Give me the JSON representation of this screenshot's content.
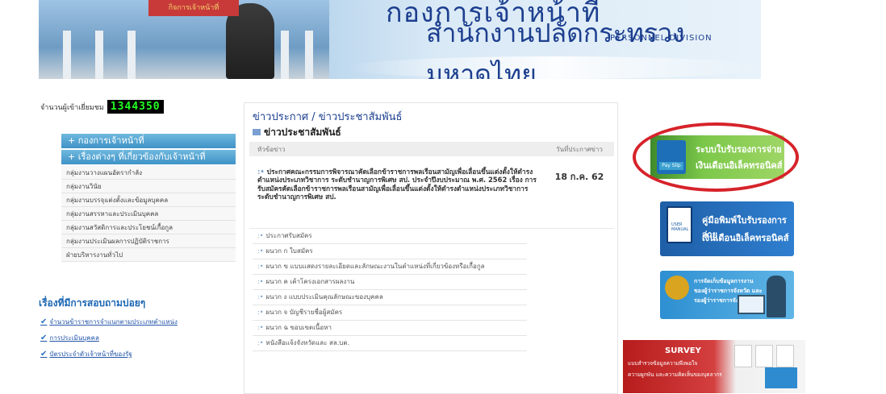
{
  "header": {
    "logo_text": "กิจการเจ้าหน้าที่",
    "title_line1": "กองการเจ้าหน้าที่",
    "title_line2": "สำนักงานปลัดกระทรวงมหาดไทย",
    "title_line3": "PERSONNEL DIVISION"
  },
  "visitor": {
    "label": "จำนวนผู้เข้าเยี่ยมชม",
    "count": "1344350"
  },
  "sidebar": {
    "section1": "+ กองการเจ้าหน้าที่",
    "section2": "+ เรื่องต่างๆ ที่เกี่ยวข้องกับเจ้าหน้าที่",
    "items": [
      {
        "label": "กลุ่มงานวางแผนอัตรากำลัง"
      },
      {
        "label": "กลุ่มงานวินัย"
      },
      {
        "label": "กลุ่มงานบรรจุแต่งตั้งและข้อมูลบุคคล"
      },
      {
        "label": "กลุ่มงานสรรหาและประเมินบุคคล"
      },
      {
        "label": "กลุ่มงานสวัสดิการและประโยชน์เกื้อกูล"
      },
      {
        "label": "กลุ่มงานประเมินผลการปฏิบัติราชการ"
      },
      {
        "label": "ฝ่ายบริหารงานทั่วไป"
      }
    ]
  },
  "faq": {
    "heading": "เรื่องที่มีการสอบถามบ่อยๆ",
    "items": [
      {
        "label": "จำนวนข้าราชการจำแนกตามประเภทตำแหน่ง"
      },
      {
        "label": "การประเมินบุคคล"
      },
      {
        "label": "บัตรประจำตัวเจ้าหน้าที่ของรัฐ"
      }
    ]
  },
  "news": {
    "title": "ข่าวประกาศ / ข่าวประชาสัมพันธ์",
    "subtitle": "ข่าวประชาสัมพันธ์",
    "col_topic": "หัวข้อข่าว",
    "col_date": "วันที่ประกาศข่าว",
    "main_item": "ประกาศคณะกรรมการพิจารณาคัดเลือกข้าราชการพลเรือนสามัญเพื่อเลื่อนขึ้นแต่งตั้งให้ดำรงตำแหน่งประเภทวิชาการ ระดับชำนาญการพิเศษ สป. ประจำปีงบประมาณ พ.ศ. 2562 เรื่อง การรับสมัครคัดเลือกข้าราชการพลเรือนสามัญเพื่อเลื่อนขึ้นแต่งตั้งให้ดำรงตำแหน่งประเภทวิชาการ ระดับชำนาญการพิเศษ สป.",
    "main_date": "18 ก.ค. 62",
    "items": [
      {
        "label": "ประกาศรับสมัคร"
      },
      {
        "label": "ผนวก ก ใบสมัคร"
      },
      {
        "label": "ผนวก ข แบบแสดงรายละเอียดและลักษณะงานในตำแหน่งที่เกี่ยวข้องหรือเกื้อกูล"
      },
      {
        "label": "ผนวก ค เค้าโครงเอกสารผลงาน"
      },
      {
        "label": "ผนวก ง แบบประเมินคุณลักษณะของบุคคล"
      },
      {
        "label": "ผนวก จ บัญชีรายชื่อผู้สมัคร"
      },
      {
        "label": "ผนวก ฉ ขอบเขตเนื้อหา"
      },
      {
        "label": "หนังสือแจ้งจังหวัดและ สล.บต."
      }
    ]
  },
  "right_banners": {
    "payslip": {
      "icon_text": "Pay Slip",
      "line1": "ระบบใบรับรองการจ่าย",
      "line2": "เงินเดือนอิเล็คทรอนิคส์"
    },
    "manual": {
      "icon_text": "USER MANUAL",
      "line1": "คู่มือพิมพ์ใบรับรองการจ่าย",
      "line2": "เงินเดือนอิเล็คทรอนิคส์"
    },
    "data": {
      "line1": "การจัดเก็บข้อมูลการงาน",
      "line2": "ของผู้ว่าราชการจังหวัด และ",
      "line3": "รองผู้ว่าราชการจังหวัด"
    },
    "survey": {
      "title": "SURVEY",
      "line1": "แบบสำรวจข้อมูลความพึงพอใจ",
      "line2": "ความผูกพัน และความคิดเห็นของบุคลากร"
    }
  },
  "colors": {
    "accent_blue": "#1d3f8f",
    "highlight_red": "#d6232a",
    "payslip_green": "#7cc84a"
  }
}
